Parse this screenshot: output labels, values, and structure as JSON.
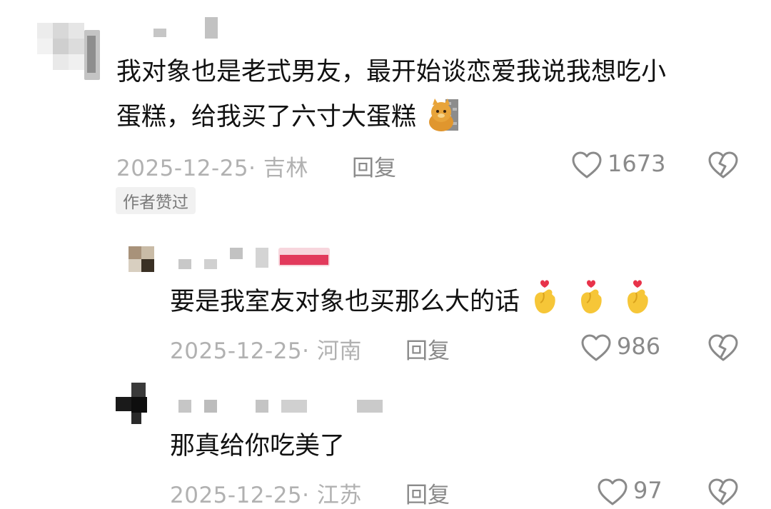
{
  "comments": [
    {
      "text_line1": "我对象也是老式男友，最开始谈恋爱我说我想吃小",
      "text_line2": "蛋糕，给我买了六寸大蛋糕",
      "date_location": "2025-12-25· 吉林",
      "reply_label": "回复",
      "likes": "1673",
      "badge": "作者赞过",
      "emoji": "cat-emoji"
    },
    {
      "text": "要是我室友对象也买那么大的话",
      "date_location": "2025-12-25· 河南",
      "reply_label": "回复",
      "likes": "986",
      "emoji": "finger-heart-emoji"
    },
    {
      "text": "那真给你吃美了",
      "date_location": "2025-12-25· 江苏",
      "reply_label": "回复",
      "likes": "97"
    }
  ],
  "colors": {
    "text": "#111111",
    "meta": "#b1b1b1",
    "action": "#8a8a8a",
    "badge_bg": "#f1f1f1"
  }
}
